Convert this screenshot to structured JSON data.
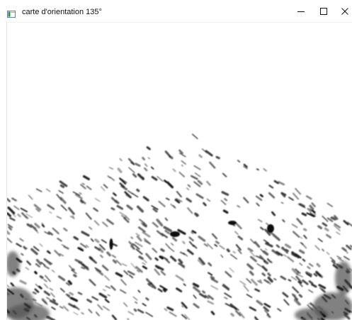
{
  "window": {
    "title": "carte d'orientation 135°",
    "icon": "app-window-icon",
    "controls": {
      "minimize_icon": "minimize-icon",
      "maximize_icon": "maximize-icon",
      "close_icon": "close-icon"
    }
  },
  "image": {
    "description": "orientation-map-135-degrees"
  }
}
